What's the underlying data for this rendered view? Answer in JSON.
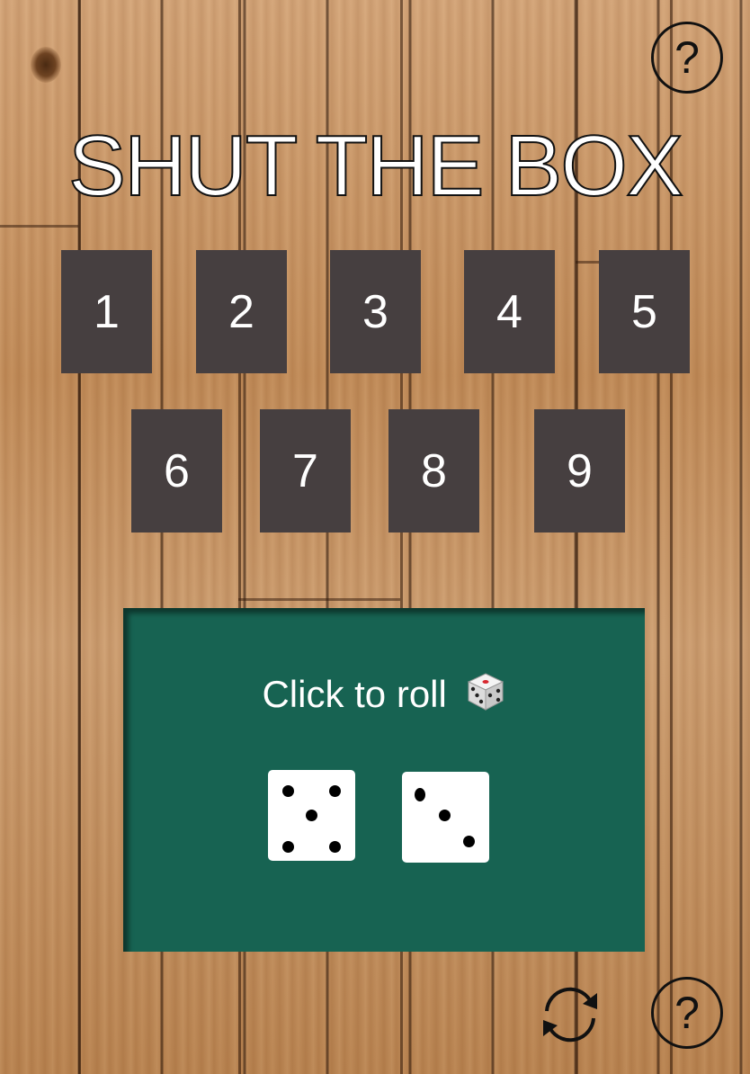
{
  "header": {
    "title": "SHUT THE BOX",
    "help_label": "?",
    "help_icon": "question-circle-icon"
  },
  "tiles": [
    "1",
    "2",
    "3",
    "4",
    "5",
    "6",
    "7",
    "8",
    "9"
  ],
  "tray": {
    "roll_label": "Click to roll",
    "roll_icon": "game-die-icon",
    "dice": [
      5,
      3
    ],
    "background_color": "#176352"
  },
  "footer": {
    "reset_icon": "refresh-icon",
    "help_label": "?",
    "help_icon": "question-circle-icon"
  },
  "colors": {
    "tile": "#463f40",
    "tile_text": "#ffffff",
    "tray": "#176352"
  }
}
